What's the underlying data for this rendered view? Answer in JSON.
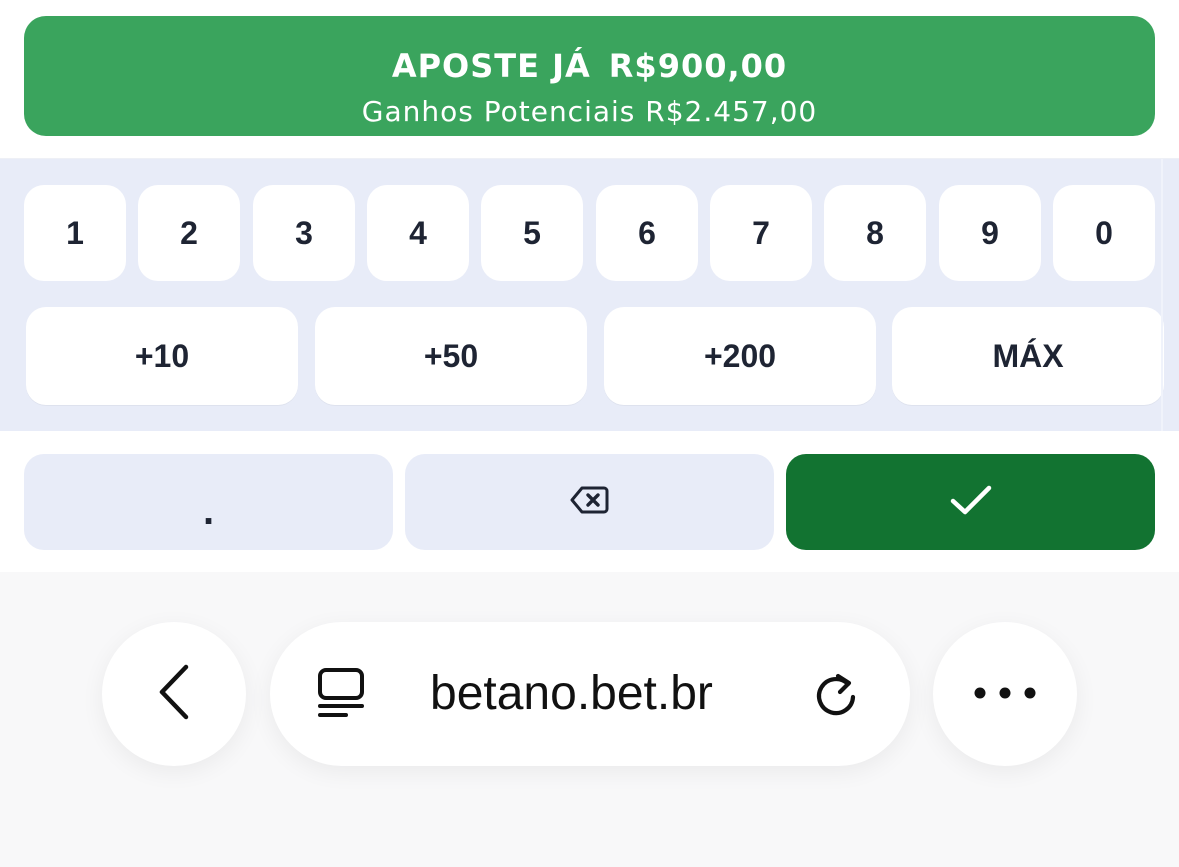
{
  "bet_button": {
    "title_prefix": "APOSTE JÁ",
    "stake": "R$900,00",
    "potential_label": "Ganhos Potenciais R$2.457,00",
    "color": "#3aa45d"
  },
  "keypad": {
    "digits": [
      "1",
      "2",
      "3",
      "4",
      "5",
      "6",
      "7",
      "8",
      "9",
      "0"
    ],
    "quick_amounts": [
      "+10",
      "+50",
      "+200",
      "MÁX"
    ],
    "decimal_key": ".",
    "backspace_icon": "backspace-icon",
    "confirm_icon": "check-icon",
    "confirm_color": "#127331"
  },
  "browser": {
    "url": "betano.bet.br",
    "back_icon": "chevron-left-icon",
    "reader_icon": "reader-mode-icon",
    "reload_icon": "reload-icon",
    "more_icon": "more-icon"
  }
}
